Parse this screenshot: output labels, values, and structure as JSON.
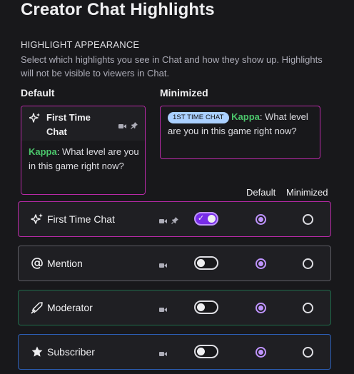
{
  "page": {
    "title": "Creator Chat Highlights"
  },
  "appearance": {
    "heading": "HIGHLIGHT APPEARANCE",
    "description": "Select which highlights you see in Chat and how they show up. Highlights will not be visible to viewers in Chat."
  },
  "preview": {
    "default_label": "Default",
    "minimized_label": "Minimized",
    "card_title": "First Time Chat",
    "badge": "1ST TIME CHAT",
    "username": "Kappa",
    "separator": ":",
    "message": " What level are you in this game right now?"
  },
  "table": {
    "col_default": "Default",
    "col_minimized": "Minimized",
    "rows": [
      {
        "label": "First Time Chat",
        "icon": "sparkle-icon",
        "border": "#b82aa7",
        "toggle_on": true,
        "selected": "default"
      },
      {
        "label": "Mention",
        "icon": "at-icon",
        "border": "#5c5c63",
        "toggle_on": false,
        "selected": "default"
      },
      {
        "label": "Moderator",
        "icon": "sword-icon",
        "border": "#1f6b4a",
        "toggle_on": false,
        "selected": "default"
      },
      {
        "label": "Subscriber",
        "icon": "star-icon",
        "border": "#2c5fb8",
        "toggle_on": false,
        "selected": "default"
      }
    ]
  },
  "colors": {
    "accent": "#bf94ff",
    "username": "#4bc56b",
    "badge": "#aad0ff",
    "first_time_border": "#b82aa7"
  }
}
